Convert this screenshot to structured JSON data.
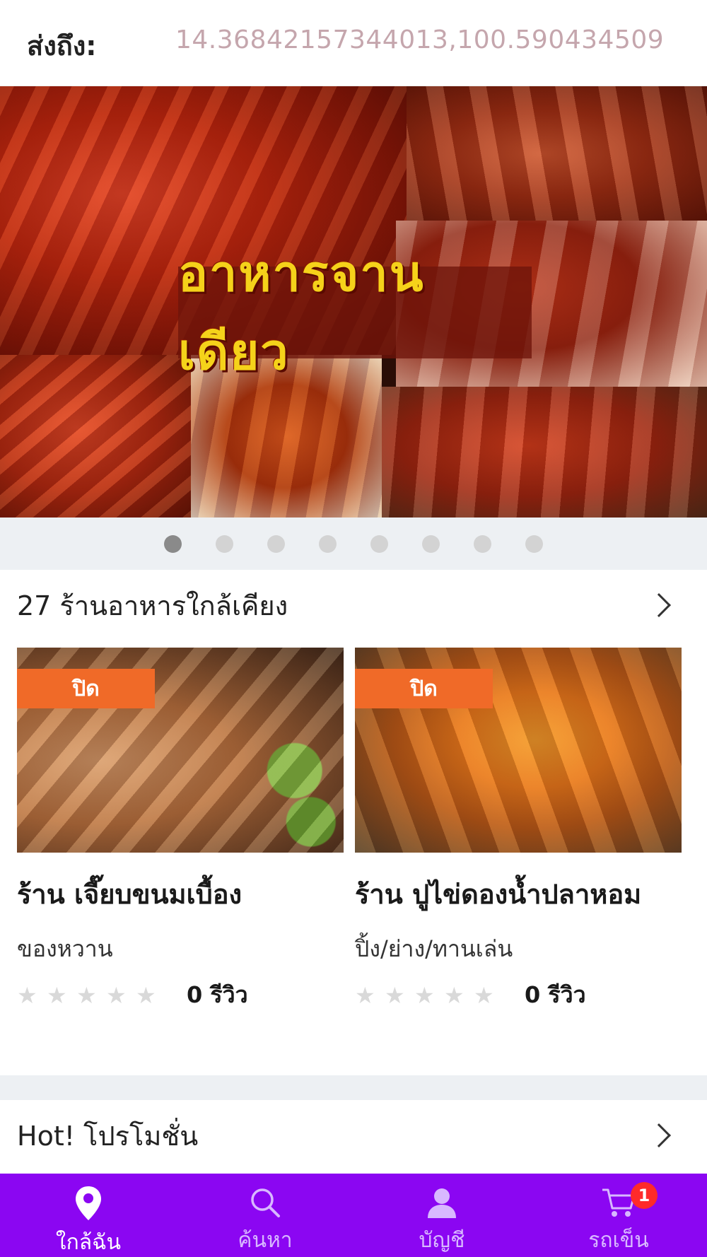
{
  "header": {
    "deliver_label": "ส่งถึง:",
    "coordinates": "14.36842157344013,100.590434509"
  },
  "banner": {
    "title": "อาหารจานเดียว",
    "slide_count": 8,
    "active_slide": 1
  },
  "nearby": {
    "title": "27 ร้านอาหารใกล้เคียง",
    "restaurants": [
      {
        "status": "ปิด",
        "name": "ร้าน เจี๊ยบขนมเบื้อง",
        "category": "ของหวาน",
        "rating": 0,
        "reviews": "0 รีวิว"
      },
      {
        "status": "ปิด",
        "name": "ร้าน ปูไข่ดองน้ำปลาหอม",
        "category": "ปิ้ง/ย่าง/ทานเล่น",
        "rating": 0,
        "reviews": "0 รีวิว"
      }
    ]
  },
  "promotions": {
    "title": "Hot! โปรโมชั่น"
  },
  "bottom_nav": {
    "items": [
      {
        "label": "ใกล้ฉัน",
        "icon": "location-pin-icon",
        "active": true
      },
      {
        "label": "ค้นหา",
        "icon": "search-icon",
        "active": false
      },
      {
        "label": "บัญชี",
        "icon": "account-icon",
        "active": false
      },
      {
        "label": "รถเข็น",
        "icon": "cart-icon",
        "active": false,
        "badge": "1"
      }
    ]
  },
  "colors": {
    "nav_background": "#8b06f2",
    "closed_badge": "#f06a28",
    "coordinates_text": "#c5a6ad",
    "cart_badge": "#ff2a2a"
  }
}
